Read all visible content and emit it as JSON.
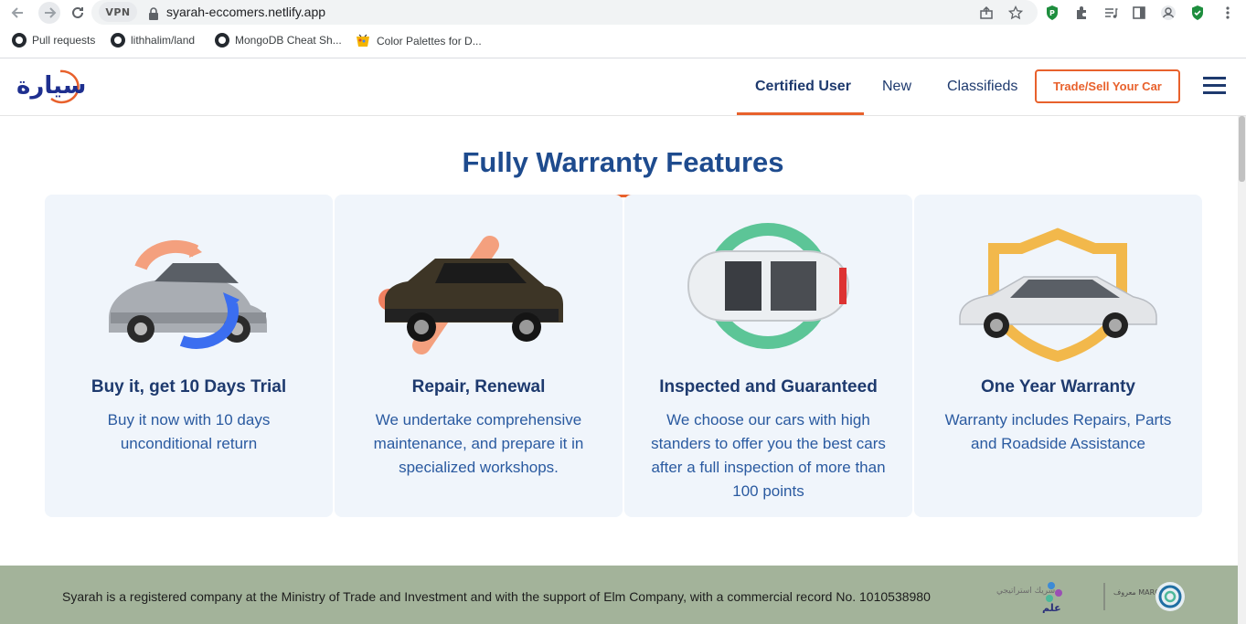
{
  "browser": {
    "url": "syarah-eccomers.netlify.app",
    "vpn_label": "VPN",
    "bookmarks": [
      {
        "label": "Pull requests"
      },
      {
        "label": "lithhalim/land"
      },
      {
        "label": "MongoDB Cheat Sh..."
      },
      {
        "label": "Color Palettes for D..."
      }
    ]
  },
  "header": {
    "logo_text": "سيارة",
    "nav": [
      {
        "label": "Certified User",
        "active": true
      },
      {
        "label": "New",
        "active": false
      },
      {
        "label": "Classifieds",
        "active": false
      }
    ],
    "cta_label": "Trade/Sell Your Car"
  },
  "section": {
    "title": "Fully Warranty Features",
    "cards": [
      {
        "title": "Buy it, get 10 Days Trial",
        "description": "Buy it now with 10 days unconditional return",
        "icon": "car-refresh-icon"
      },
      {
        "title": "Repair, Renewal",
        "description": "We undertake comprehensive maintenance, and prepare it in specialized workshops.",
        "icon": "car-repair-icon"
      },
      {
        "title": "Inspected and Guaranteed",
        "description": "We choose our cars with high standers to offer you the best cars after a full inspection of more than 100 points",
        "icon": "car-inspection-icon"
      },
      {
        "title": "One Year Warranty",
        "description": "Warranty includes Repairs, Parts and Roadside Assistance",
        "icon": "car-shield-icon"
      }
    ]
  },
  "footer": {
    "text": "Syarah is a registered company at the Ministry of Trade and Investment and with the support of Elm Company, with a commercial record No. 1010538980",
    "partner_logo_text": "شريك استراتيجي",
    "elm_logo_text": "علم",
    "maroof_logo_text": "معروف MAROOF"
  },
  "colors": {
    "brand_blue": "#1e3a6e",
    "accent_orange": "#e8612c",
    "card_bg": "#f0f5fb",
    "footer_bg": "#a3b39a"
  }
}
